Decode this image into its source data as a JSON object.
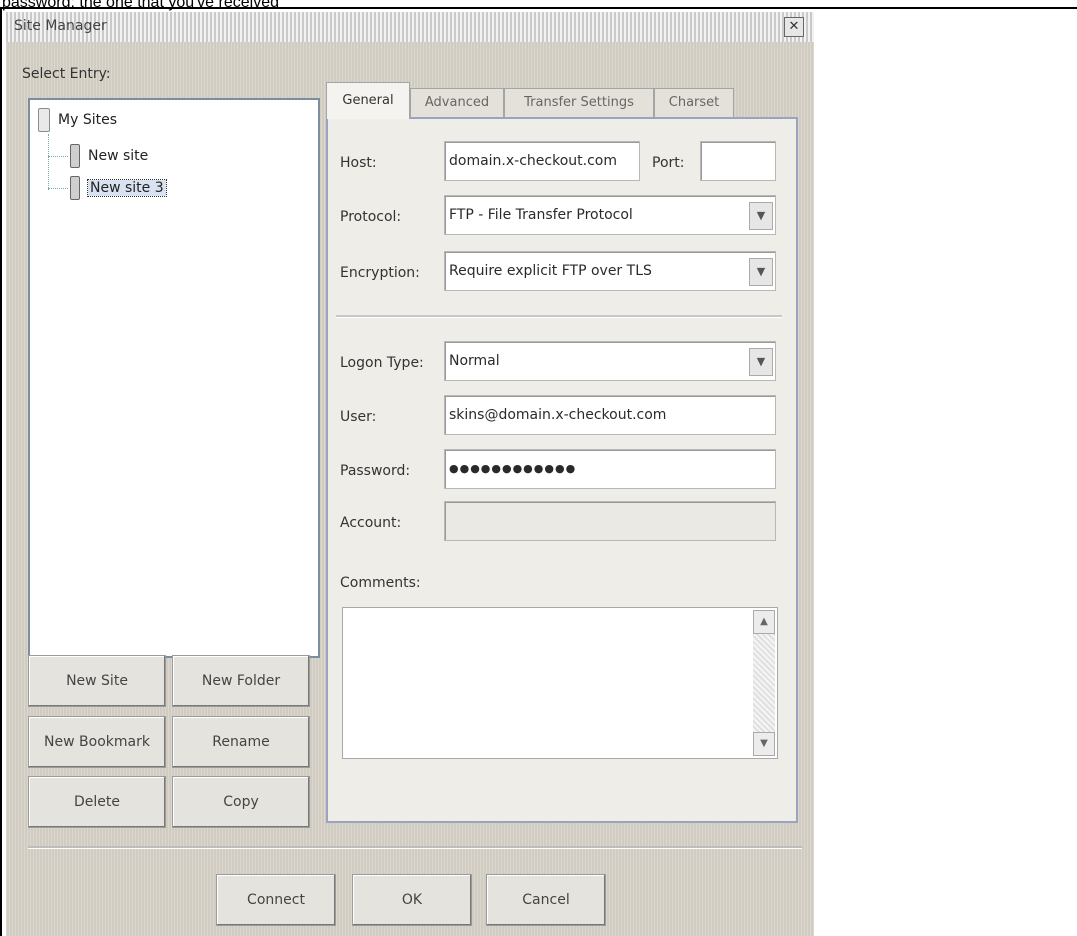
{
  "caption": "password: the one that you've received",
  "window": {
    "title": "Site Manager",
    "close_glyph": "✕"
  },
  "tree": {
    "label": "Select Entry:",
    "root": "My Sites",
    "items": [
      "New site",
      "New site 3"
    ],
    "selected_index": 1
  },
  "tabs": [
    "General",
    "Advanced",
    "Transfer Settings",
    "Charset"
  ],
  "general": {
    "host_label": "Host:",
    "host_value": "domain.x-checkout.com",
    "port_label": "Port:",
    "port_value": "",
    "protocol_label": "Protocol:",
    "protocol_value": "FTP - File Transfer Protocol",
    "encryption_label": "Encryption:",
    "encryption_value": "Require explicit FTP over TLS",
    "logon_label": "Logon Type:",
    "logon_value": "Normal",
    "user_label": "User:",
    "user_value": "skins@domain.x-checkout.com",
    "password_label": "Password:",
    "password_value": "●●●●●●●●●●●●",
    "account_label": "Account:",
    "account_value": "",
    "comments_label": "Comments:"
  },
  "left_buttons": {
    "new_site": "New Site",
    "new_folder": "New Folder",
    "new_bookmark": "New Bookmark",
    "rename": "Rename",
    "delete": "Delete",
    "copy": "Copy"
  },
  "bottom_buttons": {
    "connect": "Connect",
    "ok": "OK",
    "cancel": "Cancel"
  },
  "icons": {
    "dropdown": "chevron-down-icon",
    "scroll_up": "arrow-up-icon",
    "scroll_down": "arrow-down-icon"
  }
}
